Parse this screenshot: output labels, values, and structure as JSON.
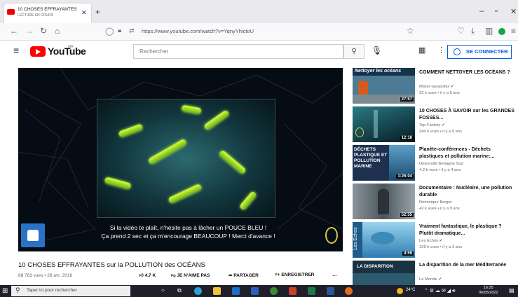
{
  "browser": {
    "tab_title": "10 CHOSES EFFRAYANTES sur l...",
    "tab_subtitle": "LECTURE EN COURS",
    "new_tab": "+",
    "url": "https://www.youtube.com/watch?v=YqnyYhictoU",
    "win_min": "–",
    "win_max": "▫",
    "win_close": "✕"
  },
  "youtube": {
    "logo_text": "YouTube",
    "region": "MA",
    "search_placeholder": "Rechercher",
    "connect_label": "SE CONNECTER"
  },
  "video": {
    "caption_line1": "Si la vidéo te plaît, n'hésite pas à lâcher un POUCE BLEU !",
    "caption_line2": "Ça prend 2 sec et ça m'encourage BEAUCOUP ! Merci d'avance !",
    "title": "10 CHOSES EFFRAYANTES sur la POLLUTION des OCÉANS",
    "meta": "88 783 vues • 28 avr. 2018",
    "likes": "4,7 K",
    "dislike_label": "JE N'AIME PAS",
    "share_label": "PARTAGER",
    "save_label": "ENREGISTRER",
    "more": "…"
  },
  "sidebar": [
    {
      "title": "COMMENT NETTOYER LES OCÉANS ?",
      "channel": "Mister Geopolitix ✔",
      "stats": "32 k vues • il y a 5 ans",
      "duration": "27:57",
      "thumb_text": "Nettoyer les océans",
      "thumb_color": "#4d7a94"
    },
    {
      "title": "10 CHOSES À SAVOIR sur les GRANDES FOSSES...",
      "channel": "Top Factory ✔",
      "stats": "340 k vues • il y a 5 ans",
      "duration": "12:18",
      "thumb_text": "",
      "thumb_color": "#0d3a45"
    },
    {
      "title": "Planète-conférences - Déchets plastiques et pollution marine:...",
      "channel": "Université Bretagne Sud",
      "stats": "4,2 k vues • il y a 4 ans",
      "duration": "1:26:04",
      "thumb_text": "DÉCHETS PLASTIQUE ET POLLUTION MARINE",
      "thumb_color": "#1d3050"
    },
    {
      "title": "Documentaire : Nucléaire, une pollution durable",
      "channel": "Dominique Berger",
      "stats": "42 k vues • il y a 9 ans",
      "duration": "52:55",
      "thumb_text": "",
      "thumb_color": "#5b6770"
    },
    {
      "title": "Vraiment fantastique, le plastique ? Plutôt dramatique...",
      "channel": "Les Echos ✔",
      "stats": "129 k vues • il y a 3 ans",
      "duration": "4:59",
      "thumb_text": "Les Echos",
      "thumb_color": "#2f7cb2"
    },
    {
      "title": "La disparition de la mer Méditerranée",
      "channel": "Le Monde ✔",
      "stats": "",
      "duration": "",
      "thumb_text": "LA DISPARITION",
      "thumb_color": "#1a3342"
    }
  ],
  "taskbar": {
    "search_placeholder": "Taper ici pour rechercher",
    "temperature": "24°C",
    "time": "16:25",
    "date": "06/05/2022"
  }
}
